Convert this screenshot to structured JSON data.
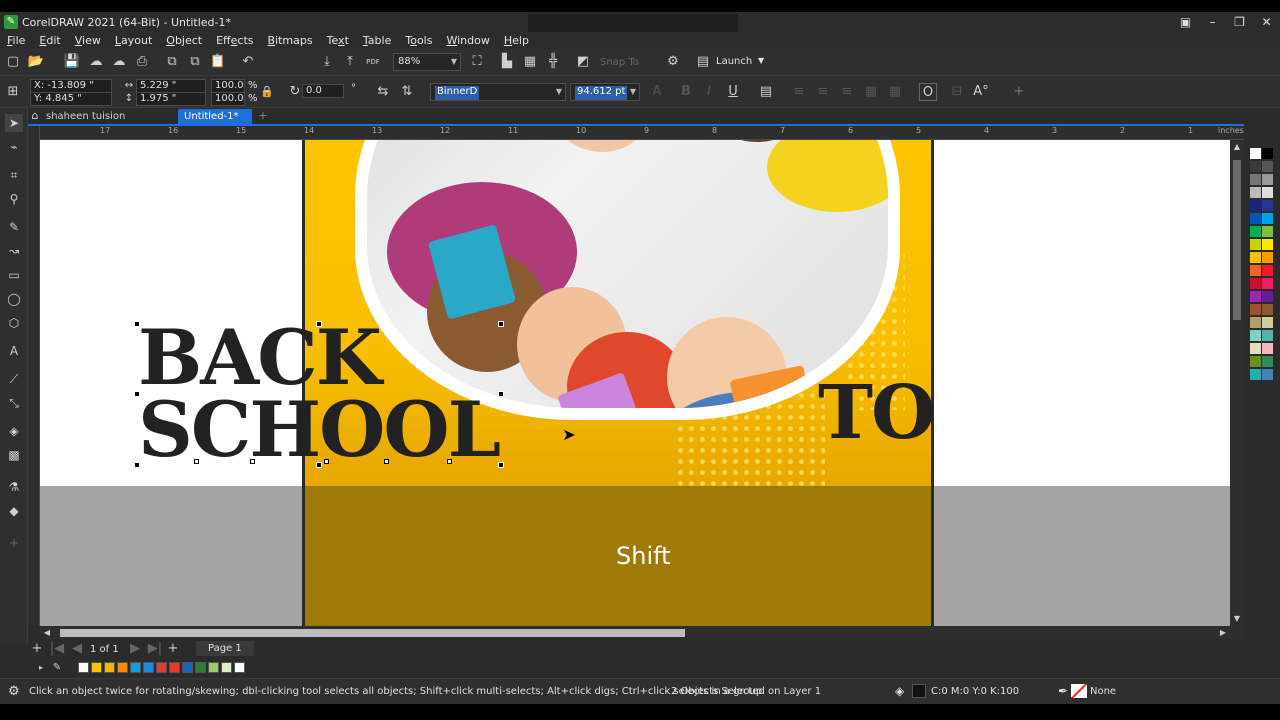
{
  "app": {
    "title": "CorelDRAW 2021 (64-Bit) - Untitled-1*"
  },
  "menu": [
    {
      "pre": "",
      "u": "F",
      "post": "ile"
    },
    {
      "pre": "",
      "u": "E",
      "post": "dit"
    },
    {
      "pre": "",
      "u": "V",
      "post": "iew"
    },
    {
      "pre": "",
      "u": "L",
      "post": "ayout"
    },
    {
      "pre": "",
      "u": "O",
      "post": "bject"
    },
    {
      "pre": "Eff",
      "u": "e",
      "post": "cts"
    },
    {
      "pre": "",
      "u": "B",
      "post": "itmaps"
    },
    {
      "pre": "Te",
      "u": "x",
      "post": "t"
    },
    {
      "pre": "",
      "u": "T",
      "post": "able"
    },
    {
      "pre": "T",
      "u": "o",
      "post": "ols"
    },
    {
      "pre": "",
      "u": "W",
      "post": "indow"
    },
    {
      "pre": "",
      "u": "H",
      "post": "elp"
    }
  ],
  "toolbar": {
    "zoom": "88%",
    "snap_to": "Snap To",
    "launch": "Launch",
    "pdf": "PDF"
  },
  "property_bar": {
    "x": "X: -13.809 \"",
    "y": "Y: 4.845 \"",
    "width": "5.229 \"",
    "height": "1.975 \"",
    "scale_w": "100.0",
    "scale_h": "100.0",
    "pct": "%",
    "rotation": "0.0",
    "degree": "°",
    "font": "BinnerD",
    "font_size": "94.612 pt"
  },
  "tabs": [
    {
      "label": "shaheen tuision center.cdr"
    },
    {
      "label": "Untitled-1*"
    }
  ],
  "ruler": {
    "ticks": [
      "17",
      "16",
      "15",
      "14",
      "13",
      "12",
      "11",
      "10",
      "9",
      "8",
      "7",
      "6",
      "5",
      "4",
      "3",
      "2",
      "1"
    ],
    "unit": "inches",
    "v_unit": "inches"
  },
  "design": {
    "line1": "BACK",
    "line2": "SCHOOL",
    "word_to": "TO",
    "overlay": "Shift"
  },
  "pagebar": {
    "page_of": "1 of 1",
    "page_tab": "Page 1"
  },
  "status": {
    "hint": "Click an object twice for rotating/skewing; dbl-clicking tool selects all objects; Shift+click multi-selects; Alt+click digs; Ctrl+click selects in a group",
    "selection": "2 Objects Selected on Layer 1",
    "fill": "C:0 M:0 Y:0 K:100",
    "outline": "None"
  },
  "colors": {
    "accent": "#1e6fd9",
    "page_yellow": "#ffc400",
    "palette": [
      "#ffffff",
      "#000000",
      "#3a3a3a",
      "#555",
      "#777",
      "#999",
      "#bbb",
      "#ddd",
      "#1a237e",
      "#283593",
      "#0057b7",
      "#00a2e8",
      "#00b050",
      "#7cc242",
      "#c3d600",
      "#ffe600",
      "#ffc000",
      "#ff9900",
      "#f26522",
      "#ed1c24",
      "#c8102e",
      "#e91e63",
      "#9c27b0",
      "#6a1b9a",
      "#a0522d",
      "#8b5a2b",
      "#b0a070",
      "#d4c9a0",
      "#7fd3c6",
      "#55b3a6",
      "#e0e0c0",
      "#f4b6c2",
      "#6b8e23",
      "#2e8b57",
      "#20b2aa",
      "#4682b4"
    ],
    "docpal": [
      "#ffffff",
      "#f7c600",
      "#ffb300",
      "#ff8c00",
      "#0aa0e0",
      "#1e88e5",
      "#e53935",
      "#e53935",
      "#1565c0",
      "#2e7d32",
      "#9ccc65",
      "#dcedc8",
      "#ffffff"
    ]
  }
}
